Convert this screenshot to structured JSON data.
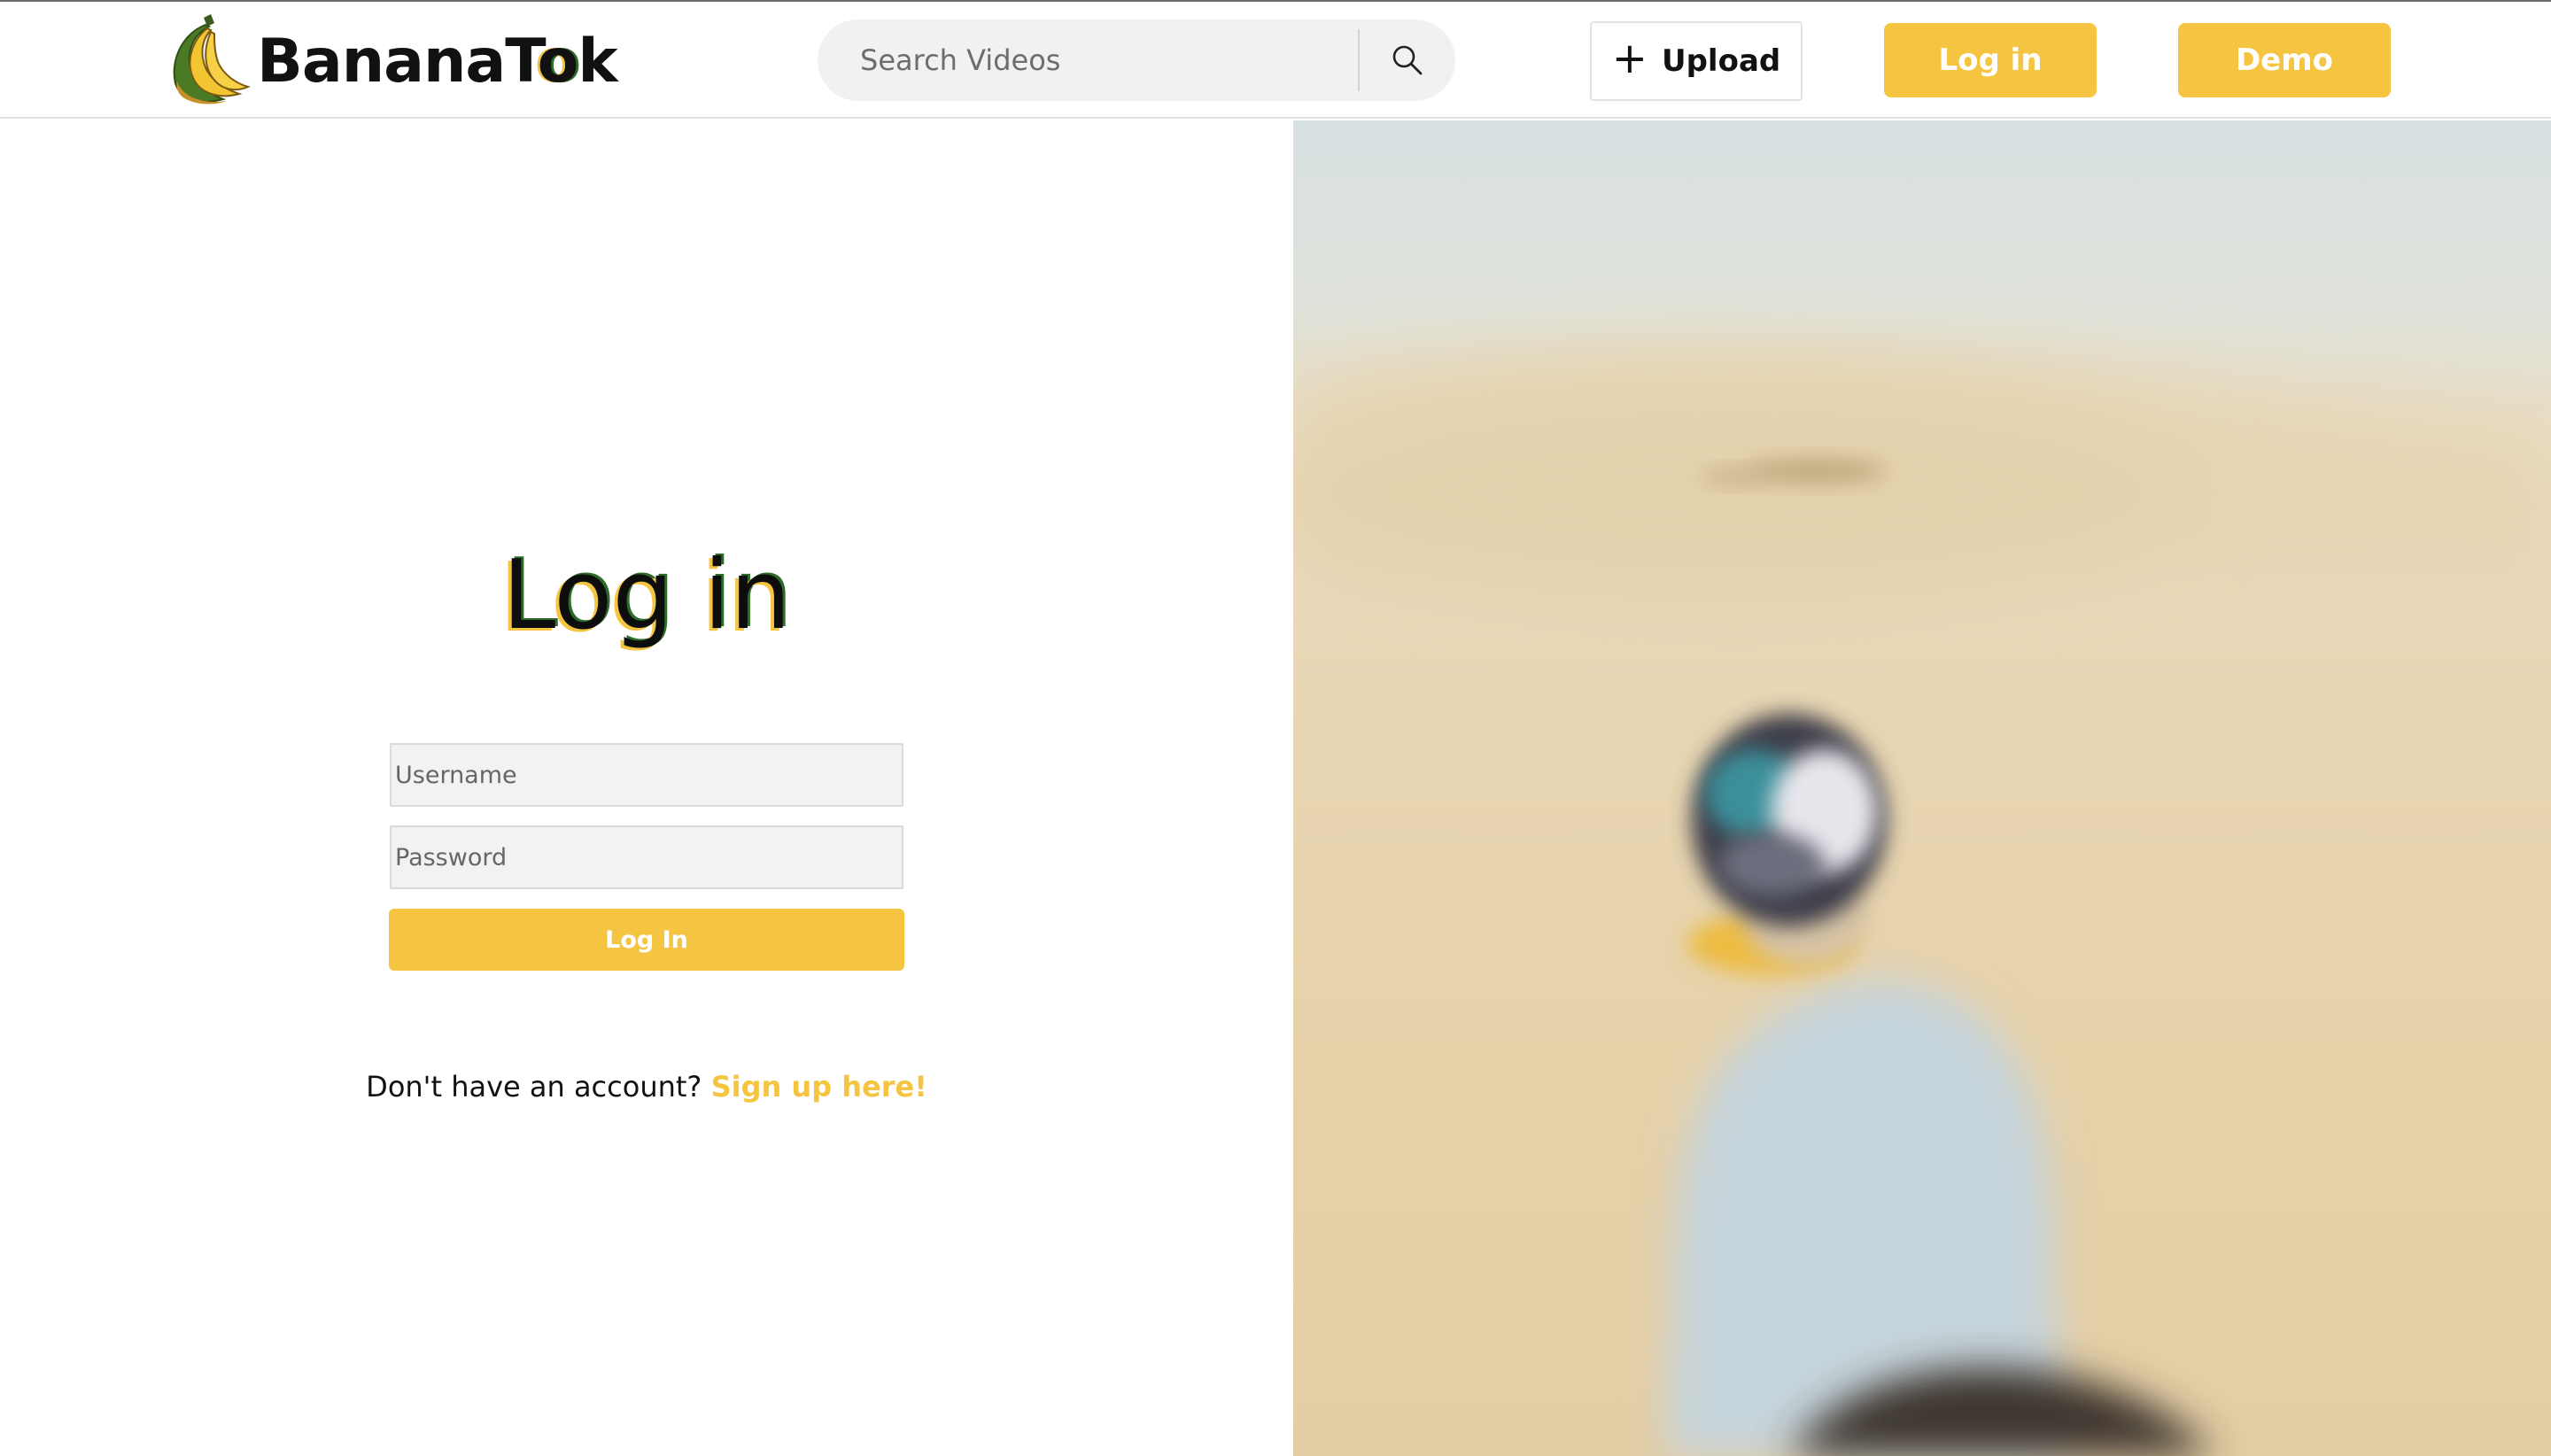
{
  "brand": {
    "name_prefix": "BananaT",
    "name_accent": "o",
    "name_suffix": "k",
    "accent_color": "#f5c542",
    "logo_icon": "banana-bunch-icon"
  },
  "header": {
    "search_placeholder": "Search Videos",
    "search_icon": "magnifier-icon",
    "upload_label": "Upload",
    "upload_icon": "plus-icon",
    "login_label": "Log in",
    "demo_label": "Demo"
  },
  "login_form": {
    "title": "Log in",
    "username_placeholder": "Username",
    "password_placeholder": "Password",
    "submit_label": "Log In",
    "signup_prompt": "Don't have an account?",
    "signup_link": "Sign up here!"
  },
  "hero": {
    "image": "blurred-desert-camel-rider-photo"
  }
}
